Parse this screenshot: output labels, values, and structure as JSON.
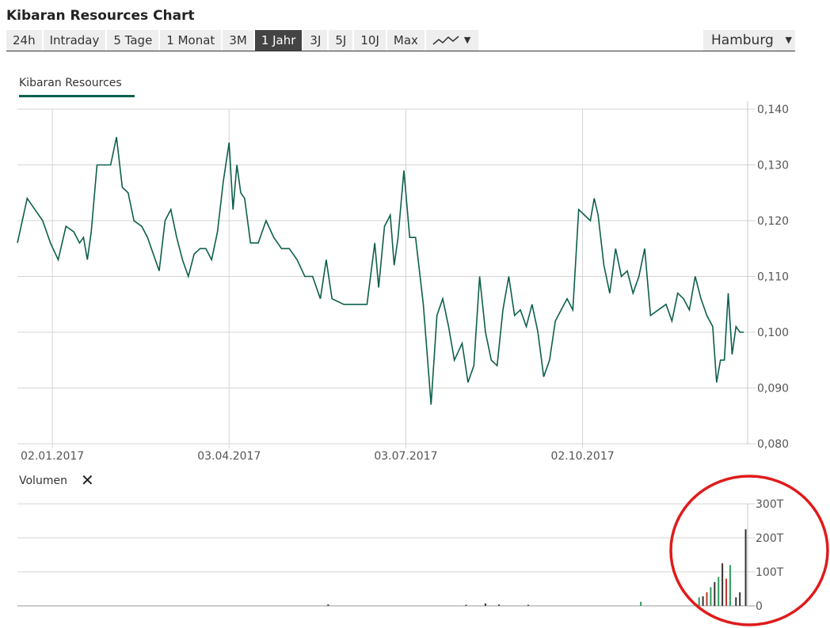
{
  "header": {
    "title": "Kibaran Resources Chart"
  },
  "tabs": [
    {
      "label": "24h",
      "active": false
    },
    {
      "label": "Intraday",
      "active": false
    },
    {
      "label": "5 Tage",
      "active": false
    },
    {
      "label": "1 Monat",
      "active": false
    },
    {
      "label": "3M",
      "active": false
    },
    {
      "label": "1 Jahr",
      "active": true
    },
    {
      "label": "3J",
      "active": false
    },
    {
      "label": "5J",
      "active": false
    },
    {
      "label": "10J",
      "active": false
    },
    {
      "label": "Max",
      "active": false
    }
  ],
  "chart_type_icon": "line-chart-icon",
  "exchange": {
    "label": "Hamburg"
  },
  "legend": {
    "series_name": "Kibaran Resources",
    "color": "#0d5f4d"
  },
  "volume": {
    "label": "Volumen",
    "close_icon": "close-icon"
  },
  "chart_data": [
    {
      "type": "line",
      "series": [
        {
          "name": "Kibaran Resources",
          "color": "#0d5f4d",
          "points": [
            [
              "2016-12-15",
              0.116
            ],
            [
              "2016-12-20",
              0.124
            ],
            [
              "2016-12-24",
              0.122
            ],
            [
              "2016-12-28",
              0.12
            ],
            [
              "2017-01-01",
              0.116
            ],
            [
              "2017-01-05",
              0.113
            ],
            [
              "2017-01-09",
              0.119
            ],
            [
              "2017-01-13",
              0.118
            ],
            [
              "2017-01-16",
              0.116
            ],
            [
              "2017-01-18",
              0.117
            ],
            [
              "2017-01-20",
              0.113
            ],
            [
              "2017-01-22",
              0.118
            ],
            [
              "2017-01-25",
              0.13
            ],
            [
              "2017-01-28",
              0.13
            ],
            [
              "2017-02-01",
              0.13
            ],
            [
              "2017-02-04",
              0.135
            ],
            [
              "2017-02-07",
              0.126
            ],
            [
              "2017-02-10",
              0.125
            ],
            [
              "2017-02-13",
              0.12
            ],
            [
              "2017-02-17",
              0.119
            ],
            [
              "2017-02-20",
              0.117
            ],
            [
              "2017-02-23",
              0.114
            ],
            [
              "2017-02-26",
              0.111
            ],
            [
              "2017-03-01",
              0.12
            ],
            [
              "2017-03-04",
              0.122
            ],
            [
              "2017-03-07",
              0.117
            ],
            [
              "2017-03-10",
              0.113
            ],
            [
              "2017-03-13",
              0.11
            ],
            [
              "2017-03-16",
              0.114
            ],
            [
              "2017-03-19",
              0.115
            ],
            [
              "2017-03-22",
              0.115
            ],
            [
              "2017-03-25",
              0.113
            ],
            [
              "2017-03-28",
              0.118
            ],
            [
              "2017-03-31",
              0.127
            ],
            [
              "2017-04-03",
              0.134
            ],
            [
              "2017-04-05",
              0.122
            ],
            [
              "2017-04-07",
              0.13
            ],
            [
              "2017-04-09",
              0.125
            ],
            [
              "2017-04-11",
              0.124
            ],
            [
              "2017-04-14",
              0.116
            ],
            [
              "2017-04-18",
              0.116
            ],
            [
              "2017-04-22",
              0.12
            ],
            [
              "2017-04-26",
              0.117
            ],
            [
              "2017-04-30",
              0.115
            ],
            [
              "2017-05-04",
              0.115
            ],
            [
              "2017-05-08",
              0.113
            ],
            [
              "2017-05-12",
              0.11
            ],
            [
              "2017-05-16",
              0.11
            ],
            [
              "2017-05-20",
              0.106
            ],
            [
              "2017-05-23",
              0.113
            ],
            [
              "2017-05-26",
              0.106
            ],
            [
              "2017-06-01",
              0.105
            ],
            [
              "2017-06-07",
              0.105
            ],
            [
              "2017-06-13",
              0.105
            ],
            [
              "2017-06-17",
              0.116
            ],
            [
              "2017-06-19",
              0.108
            ],
            [
              "2017-06-22",
              0.119
            ],
            [
              "2017-06-25",
              0.121
            ],
            [
              "2017-06-27",
              0.112
            ],
            [
              "2017-06-29",
              0.117
            ],
            [
              "2017-07-02",
              0.129
            ],
            [
              "2017-07-05",
              0.117
            ],
            [
              "2017-07-08",
              0.117
            ],
            [
              "2017-07-12",
              0.105
            ],
            [
              "2017-07-16",
              0.087
            ],
            [
              "2017-07-19",
              0.103
            ],
            [
              "2017-07-22",
              0.106
            ],
            [
              "2017-07-25",
              0.101
            ],
            [
              "2017-07-28",
              0.095
            ],
            [
              "2017-08-01",
              0.098
            ],
            [
              "2017-08-04",
              0.091
            ],
            [
              "2017-08-07",
              0.094
            ],
            [
              "2017-08-10",
              0.11
            ],
            [
              "2017-08-13",
              0.1
            ],
            [
              "2017-08-16",
              0.095
            ],
            [
              "2017-08-19",
              0.094
            ],
            [
              "2017-08-22",
              0.104
            ],
            [
              "2017-08-25",
              0.11
            ],
            [
              "2017-08-28",
              0.103
            ],
            [
              "2017-08-31",
              0.104
            ],
            [
              "2017-09-03",
              0.101
            ],
            [
              "2017-09-06",
              0.105
            ],
            [
              "2017-09-09",
              0.1
            ],
            [
              "2017-09-12",
              0.092
            ],
            [
              "2017-09-15",
              0.095
            ],
            [
              "2017-09-18",
              0.102
            ],
            [
              "2017-09-21",
              0.104
            ],
            [
              "2017-09-24",
              0.106
            ],
            [
              "2017-09-27",
              0.104
            ],
            [
              "2017-09-30",
              0.122
            ],
            [
              "2017-10-03",
              0.121
            ],
            [
              "2017-10-06",
              0.12
            ],
            [
              "2017-10-08",
              0.124
            ],
            [
              "2017-10-10",
              0.121
            ],
            [
              "2017-10-13",
              0.112
            ],
            [
              "2017-10-16",
              0.107
            ],
            [
              "2017-10-19",
              0.115
            ],
            [
              "2017-10-22",
              0.11
            ],
            [
              "2017-10-25",
              0.111
            ],
            [
              "2017-10-28",
              0.107
            ],
            [
              "2017-10-31",
              0.11
            ],
            [
              "2017-11-03",
              0.115
            ],
            [
              "2017-11-06",
              0.103
            ],
            [
              "2017-11-10",
              0.104
            ],
            [
              "2017-11-14",
              0.105
            ],
            [
              "2017-11-17",
              0.102
            ],
            [
              "2017-11-20",
              0.107
            ],
            [
              "2017-11-23",
              0.106
            ],
            [
              "2017-11-26",
              0.104
            ],
            [
              "2017-11-29",
              0.11
            ],
            [
              "2017-12-02",
              0.106
            ],
            [
              "2017-12-05",
              0.103
            ],
            [
              "2017-12-08",
              0.101
            ],
            [
              "2017-12-10",
              0.091
            ],
            [
              "2017-12-12",
              0.095
            ],
            [
              "2017-12-14",
              0.095
            ],
            [
              "2017-12-16",
              0.107
            ],
            [
              "2017-12-18",
              0.096
            ],
            [
              "2017-12-20",
              0.101
            ],
            [
              "2017-12-22",
              0.1
            ],
            [
              "2017-12-24",
              0.1
            ]
          ]
        }
      ],
      "y_ticks": [
        "0,140",
        "0,130",
        "0,120",
        "0,110",
        "0,100",
        "0,090",
        "0,080"
      ],
      "y_values": [
        0.14,
        0.13,
        0.12,
        0.11,
        0.1,
        0.09,
        0.08
      ],
      "ylim": [
        0.08,
        0.14
      ],
      "xlim": [
        "2016-12-15",
        "2017-12-26"
      ],
      "x_ticks": [
        {
          "date": "2017-01-02",
          "label": "02.01.2017"
        },
        {
          "date": "2017-04-03",
          "label": "03.04.2017"
        },
        {
          "date": "2017-07-03",
          "label": "03.07.2017"
        },
        {
          "date": "2017-10-02",
          "label": "02.10.2017"
        }
      ],
      "grid": true,
      "y_axis_side": "right"
    },
    {
      "type": "bar",
      "name": "Volumen",
      "y_ticks": [
        "300T",
        "200T",
        "100T",
        "0"
      ],
      "y_values": [
        300000,
        200000,
        100000,
        0
      ],
      "ylim": [
        0,
        300000
      ],
      "xlim": [
        "2016-12-15",
        "2017-12-26"
      ],
      "bars": [
        {
          "date": "2017-05-24",
          "value": 4000,
          "color": "#333333"
        },
        {
          "date": "2017-08-03",
          "value": 3000,
          "color": "#333333"
        },
        {
          "date": "2017-08-13",
          "value": 7000,
          "color": "#333333"
        },
        {
          "date": "2017-08-20",
          "value": 4000,
          "color": "#333333"
        },
        {
          "date": "2017-09-04",
          "value": 3000,
          "color": "#333333"
        },
        {
          "date": "2017-11-01",
          "value": 12000,
          "color": "#2e9c5e"
        },
        {
          "date": "2017-12-01",
          "value": 25000,
          "color": "#2e9c5e"
        },
        {
          "date": "2017-12-03",
          "value": 28000,
          "color": "#333333"
        },
        {
          "date": "2017-12-05",
          "value": 40000,
          "color": "#c0392b"
        },
        {
          "date": "2017-12-07",
          "value": 55000,
          "color": "#2e9c5e"
        },
        {
          "date": "2017-12-09",
          "value": 70000,
          "color": "#333333"
        },
        {
          "date": "2017-12-11",
          "value": 85000,
          "color": "#2e9c5e"
        },
        {
          "date": "2017-12-13",
          "value": 125000,
          "color": "#333333"
        },
        {
          "date": "2017-12-15",
          "value": 80000,
          "color": "#c0392b"
        },
        {
          "date": "2017-12-17",
          "value": 120000,
          "color": "#2e9c5e"
        },
        {
          "date": "2017-12-20",
          "value": 25000,
          "color": "#333333"
        },
        {
          "date": "2017-12-22",
          "value": 40000,
          "color": "#333333"
        },
        {
          "date": "2017-12-25",
          "value": 225000,
          "color": "#333333"
        }
      ],
      "grid": true,
      "y_axis_side": "right"
    }
  ],
  "annotation": {
    "shape": "circle",
    "color": "#e01b1b"
  }
}
